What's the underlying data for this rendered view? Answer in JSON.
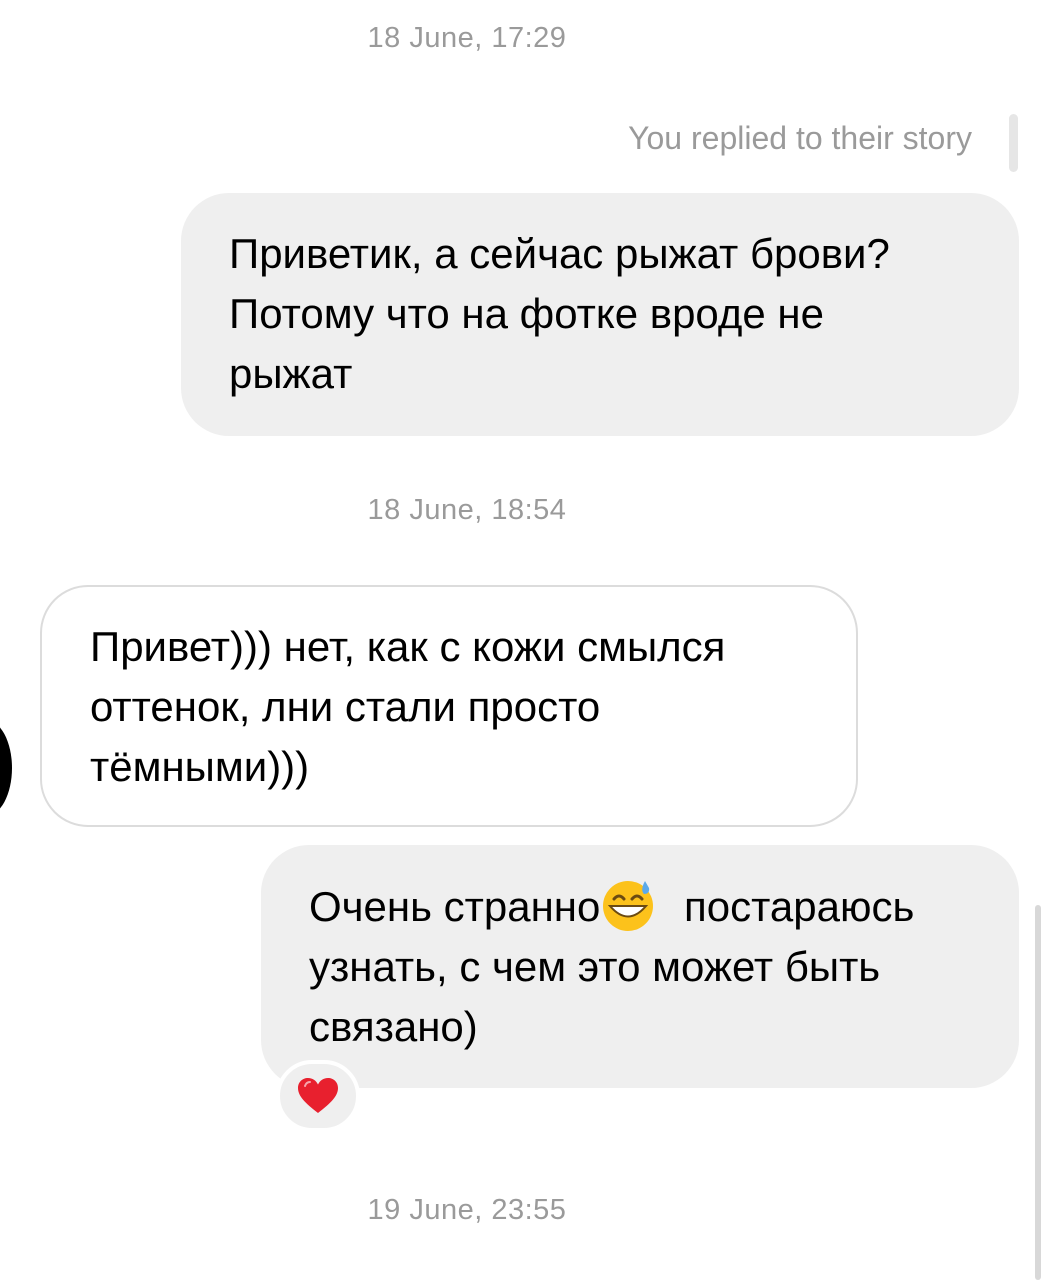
{
  "conversation": {
    "messages": [
      {
        "type": "timestamp",
        "text": "18 June, 17:29"
      },
      {
        "type": "reply_note",
        "text": "You replied to their story"
      },
      {
        "type": "outgoing",
        "text": "Приветик, а сейчас рыжат брови?\nПотому что на фотке вроде не\nрыжат"
      },
      {
        "type": "timestamp",
        "text": "18 June, 18:54"
      },
      {
        "type": "incoming",
        "text": "Привет))) нет, как с кожи смылся\nоттенок, лни стали просто\nтёмными)))"
      },
      {
        "type": "outgoing",
        "text_before_emoji": "Очень странно",
        "emoji": "grinning-face-with-sweat-icon",
        "text_after_emoji": " постараюсь\nузнать, с чем это может быть\nсвязано)",
        "reaction": "red-heart-icon"
      },
      {
        "type": "timestamp",
        "text": "19 June, 23:55"
      }
    ]
  },
  "colors": {
    "outgoing_bubble": "#efefef",
    "incoming_border": "#dcdcdc",
    "meta_text": "#9a9a9a",
    "heart": "#e8202e"
  }
}
